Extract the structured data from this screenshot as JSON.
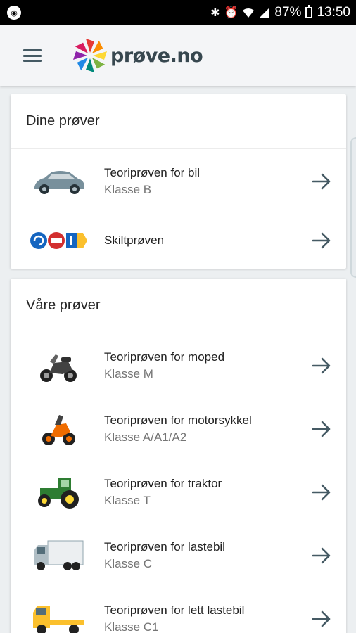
{
  "status_bar": {
    "battery": "87%",
    "time": "13:50",
    "icons": [
      "bluetooth-icon",
      "alarm-icon",
      "wifi-icon",
      "signal-icon",
      "battery-icon"
    ]
  },
  "app_bar": {
    "menu_icon": "hamburger-menu-icon",
    "logo_text": "prøve.no"
  },
  "section_yours": {
    "title": "Dine prøver",
    "items": [
      {
        "title": "Teoriprøven for bil",
        "subtitle": "Klasse B",
        "icon": "car-icon"
      },
      {
        "title": "Skiltprøven",
        "subtitle": "",
        "icon": "road-signs-icon"
      }
    ]
  },
  "section_ours": {
    "title": "Våre prøver",
    "items": [
      {
        "title": "Teoriprøven for moped",
        "subtitle": "Klasse M",
        "icon": "moped-icon"
      },
      {
        "title": "Teoriprøven for motorsykkel",
        "subtitle": "Klasse A/A1/A2",
        "icon": "motorcycle-icon"
      },
      {
        "title": "Teoriprøven for traktor",
        "subtitle": "Klasse T",
        "icon": "tractor-icon"
      },
      {
        "title": "Teoriprøven for lastebil",
        "subtitle": "Klasse C",
        "icon": "truck-icon"
      },
      {
        "title": "Teoriprøven for lett lastebil",
        "subtitle": "Klasse C1",
        "icon": "light-truck-icon"
      }
    ]
  },
  "colors": {
    "background": "#eceff1",
    "arrow": "#455a64",
    "subtitle": "#757575"
  }
}
